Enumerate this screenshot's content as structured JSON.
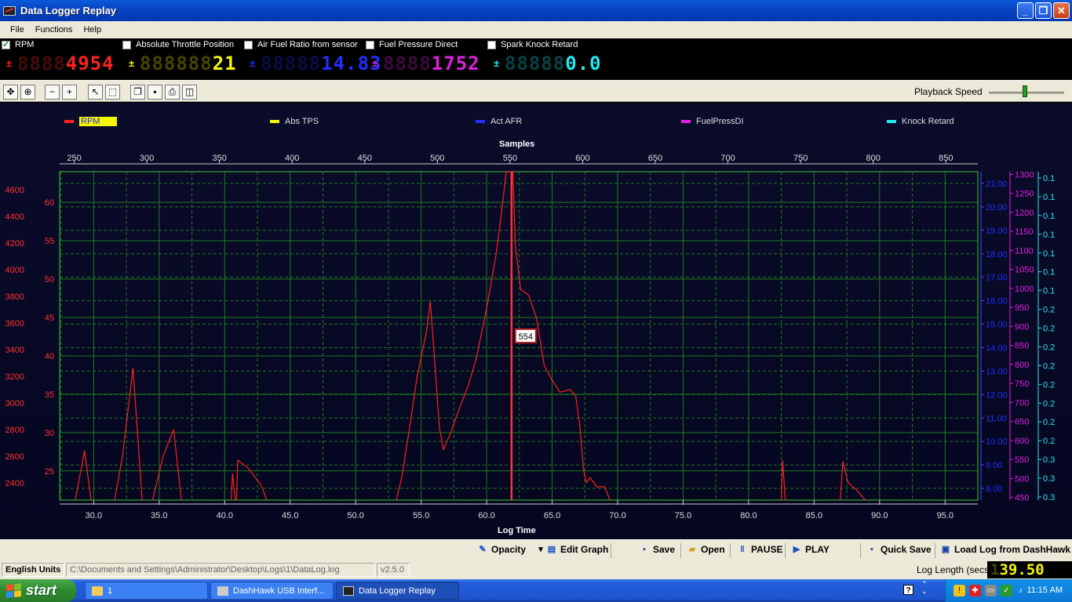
{
  "window": {
    "title": "Data Logger Replay"
  },
  "menu": [
    "File",
    "Functions",
    "Help"
  ],
  "channels": [
    {
      "label": "RPM",
      "checked": true,
      "digits": "4954",
      "ghost": "8888",
      "color": "#ff2020"
    },
    {
      "label": "Absolute Throttle Position",
      "checked": false,
      "digits": "21",
      "ghost": "888888",
      "color": "#f6f600"
    },
    {
      "label": "Air Fuel Ratio from sensor",
      "checked": false,
      "digits": "14.83",
      "ghost": "88888",
      "color": "#2030ff"
    },
    {
      "label": "Fuel Pressure Direct",
      "checked": false,
      "digits": "1752",
      "ghost": "8888",
      "color": "#e020e0"
    },
    {
      "label": "Spark Knock Retard",
      "checked": false,
      "digits": "0.0",
      "ghost": "88888",
      "color": "#20e8f0"
    }
  ],
  "toolbar": {
    "icons": [
      "pan-icon",
      "zoom-area-icon",
      "zoom-out-icon",
      "zoom-in-icon",
      "pointer-icon",
      "select-box-icon",
      "copy-icon",
      "save-icon",
      "print-icon",
      "print-preview-icon"
    ],
    "playback_label": "Playback Speed",
    "playback_speed": 0.48
  },
  "legend": [
    {
      "name": "RPM",
      "color": "#ff2020"
    },
    {
      "name": "Abs TPS",
      "color": "#f6f600"
    },
    {
      "name": "Act AFR",
      "color": "#2030ff"
    },
    {
      "name": "FuelPressDI",
      "color": "#e020e0"
    },
    {
      "name": "Knock Retard",
      "color": "#20e8f0"
    }
  ],
  "chart_data": {
    "type": "line",
    "x_top_label": "Samples",
    "x_top_ticks": [
      250,
      300,
      350,
      400,
      450,
      500,
      550,
      600,
      650,
      700,
      750,
      800,
      850
    ],
    "x_bottom_label": "Log Time",
    "x_bottom_ticks": [
      30.0,
      35.0,
      40.0,
      45.0,
      50.0,
      55.0,
      60.0,
      65.0,
      70.0,
      75.0,
      80.0,
      85.0,
      90.0,
      95.0
    ],
    "x_range": [
      27.4,
      97.5
    ],
    "y_axes": [
      {
        "name": "RPM",
        "color": "#ff3030",
        "ticks": [
          2400,
          2600,
          2800,
          3000,
          3200,
          3400,
          3600,
          3800,
          4000,
          4200,
          4400,
          4600
        ],
        "range": [
          2270,
          4735
        ]
      },
      {
        "name": "Abs TPS",
        "color": "#ff3030",
        "ticks": [
          25,
          30,
          35,
          40,
          45,
          50,
          55,
          60
        ],
        "range": [
          21.2,
          64.0
        ]
      },
      {
        "name": "Act AFR",
        "color": "#2030ff",
        "ticks": [
          "8.00",
          "9.00",
          "10.00",
          "11.00",
          "12.00",
          "13.00",
          "14.00",
          "15.00",
          "16.00",
          "17.00",
          "18.00",
          "19.00",
          "20.00",
          "21.00"
        ],
        "range": [
          7.5,
          21.5
        ]
      },
      {
        "name": "FuelPressDI",
        "color": "#e020e0",
        "ticks": [
          450,
          500,
          550,
          600,
          650,
          700,
          750,
          800,
          850,
          900,
          950,
          1000,
          1050,
          1100,
          1150,
          1200,
          1250,
          1300
        ],
        "range": [
          443,
          1307
        ]
      },
      {
        "name": "Knock Retard",
        "color": "#20e8f0",
        "ticks": [
          "0.1",
          "0.1",
          "0.1",
          "0.1",
          "0.1",
          "0.1",
          "0.1",
          "0.2",
          "0.2",
          "0.2",
          "0.2",
          "0.2",
          "0.2",
          "0.2",
          "0.2",
          "0.3",
          "0.3",
          "0.3"
        ],
        "range": [
          0,
          1
        ]
      }
    ],
    "cursor": {
      "x": 61.9,
      "label": "554"
    },
    "series": [
      {
        "name": "RPM",
        "color": "#ff2020",
        "points": [
          [
            28.6,
            2270
          ],
          [
            29.3,
            2640
          ],
          [
            29.8,
            2270
          ],
          [
            31.6,
            2270
          ],
          [
            32.2,
            2600
          ],
          [
            33.0,
            3260
          ],
          [
            33.7,
            2270
          ],
          [
            34.5,
            2270
          ],
          [
            35.3,
            2600
          ],
          [
            36.1,
            2800
          ],
          [
            36.7,
            2270
          ],
          [
            40.5,
            2270
          ],
          [
            40.6,
            2470
          ],
          [
            40.8,
            2270
          ],
          [
            40.9,
            2270
          ],
          [
            41.0,
            2570
          ],
          [
            41.8,
            2510
          ],
          [
            42.8,
            2380
          ],
          [
            43.2,
            2270
          ],
          [
            53.1,
            2270
          ],
          [
            53.5,
            2430
          ],
          [
            54.1,
            2800
          ],
          [
            54.7,
            3200
          ],
          [
            55.4,
            3530
          ],
          [
            55.7,
            3760
          ],
          [
            56.0,
            3360
          ],
          [
            56.4,
            2810
          ],
          [
            56.7,
            2650
          ],
          [
            57.2,
            2760
          ],
          [
            57.7,
            2900
          ],
          [
            58.6,
            3130
          ],
          [
            59.2,
            3330
          ],
          [
            60.0,
            3710
          ],
          [
            60.7,
            4100
          ],
          [
            61.0,
            4320
          ],
          [
            61.5,
            4735
          ],
          [
            62.0,
            4735
          ],
          [
            62.2,
            4170
          ],
          [
            62.6,
            3850
          ],
          [
            63.2,
            3810
          ],
          [
            63.8,
            3640
          ],
          [
            64.4,
            3280
          ],
          [
            65.0,
            3170
          ],
          [
            65.6,
            3080
          ],
          [
            66.4,
            3100
          ],
          [
            66.8,
            3050
          ],
          [
            67.1,
            2840
          ],
          [
            67.4,
            2500
          ],
          [
            67.6,
            2400
          ],
          [
            67.9,
            2440
          ],
          [
            68.4,
            2370
          ],
          [
            69.0,
            2370
          ],
          [
            69.3,
            2300
          ],
          [
            69.4,
            2270
          ],
          [
            82.5,
            2270
          ],
          [
            82.6,
            2570
          ],
          [
            82.8,
            2270
          ],
          [
            87.0,
            2270
          ],
          [
            87.2,
            2560
          ],
          [
            87.6,
            2400
          ],
          [
            88.3,
            2340
          ],
          [
            88.9,
            2270
          ]
        ]
      }
    ]
  },
  "bottom_toolbar": {
    "opacity": "Opacity",
    "edit_graph": "Edit Graph",
    "save": "Save",
    "open": "Open",
    "pause": "PAUSE",
    "play": "PLAY",
    "quick_save": "Quick Save",
    "load_log": "Load Log from DashHawk"
  },
  "status": {
    "units": "English Units",
    "path": "C:\\Documents and Settings\\Administrator\\Desktop\\Logs\\1\\DataLog.log",
    "version": "v2.5.0",
    "log_length_label": "Log Length (secs)",
    "log_length_value": "39.50",
    "log_length_ghost": "1"
  },
  "taskbar": {
    "start": "start",
    "tasks": [
      {
        "label": "1",
        "active": false
      },
      {
        "label": "DashHawk USB Interf...",
        "active": false
      },
      {
        "label": "Data Logger Replay",
        "active": true
      }
    ],
    "clock": "11:15 AM"
  }
}
